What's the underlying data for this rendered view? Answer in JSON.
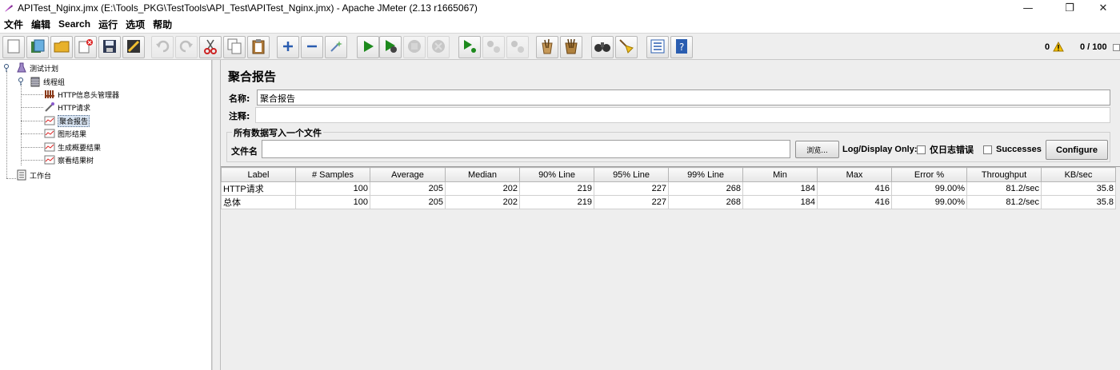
{
  "window": {
    "title": "APITest_Nginx.jmx (E:\\Tools_PKG\\TestTools\\API_Test\\APITest_Nginx.jmx) - Apache JMeter (2.13 r1665067)"
  },
  "menu": [
    "文件",
    "编辑",
    "Search",
    "运行",
    "选项",
    "帮助"
  ],
  "toolbar": {
    "warning_count": "0",
    "thread_status": "0 / 100"
  },
  "tree": {
    "nodes": [
      {
        "label": "测试计划",
        "icon": "flask-icon"
      },
      {
        "label": "线程组",
        "icon": "spool-icon"
      },
      {
        "label": "HTTP信息头管理器",
        "icon": "toolbox-icon"
      },
      {
        "label": "HTTP请求",
        "icon": "pipette-icon"
      },
      {
        "label": "聚合报告",
        "icon": "chart-icon"
      },
      {
        "label": "图形结果",
        "icon": "chart-icon"
      },
      {
        "label": "生成概要结果",
        "icon": "chart-icon"
      },
      {
        "label": "察看结果树",
        "icon": "chart-icon"
      },
      {
        "label": "工作台",
        "icon": "notepad-icon"
      }
    ]
  },
  "panel": {
    "title": "聚合报告",
    "name_label": "名称:",
    "name_value": "聚合报告",
    "comment_label": "注释:",
    "comment_value": "",
    "file_group_title": "所有数据写入一个文件",
    "filename_label": "文件名",
    "filename_value": "",
    "browse_label": "浏览...",
    "log_display_label": "Log/Display Only:",
    "errors_only_label": "仅日志错误",
    "successes_label": "Successes",
    "configure_label": "Configure"
  },
  "table": {
    "columns": [
      "Label",
      "# Samples",
      "Average",
      "Median",
      "90% Line",
      "95% Line",
      "99% Line",
      "Min",
      "Max",
      "Error %",
      "Throughput",
      "KB/sec"
    ],
    "rows": [
      [
        "HTTP请求",
        "100",
        "205",
        "202",
        "219",
        "227",
        "268",
        "184",
        "416",
        "99.00%",
        "81.2/sec",
        "35.8"
      ],
      [
        "总体",
        "100",
        "205",
        "202",
        "219",
        "227",
        "268",
        "184",
        "416",
        "99.00%",
        "81.2/sec",
        "35.8"
      ]
    ]
  },
  "colors": {
    "toolbar_bg": "#eeeeee",
    "selection": "#d8e4f2",
    "run_green": "#1d8a1d"
  }
}
